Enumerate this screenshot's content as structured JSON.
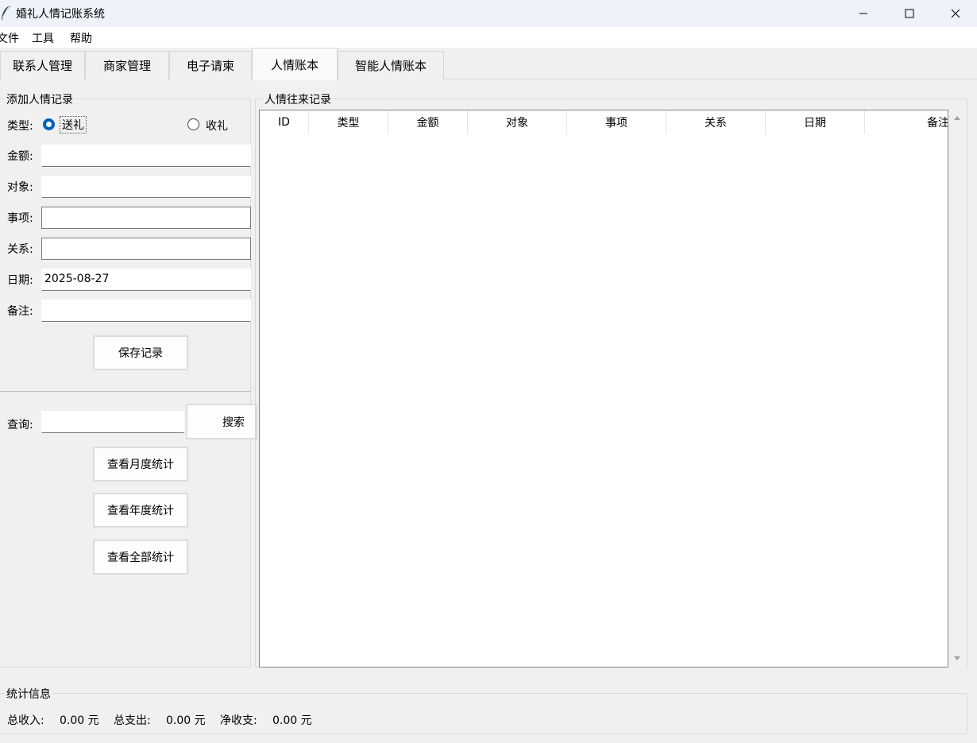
{
  "window": {
    "title": "婚礼人情记账系统"
  },
  "menu": [
    "文件",
    "工具",
    "帮助"
  ],
  "tabs": [
    "联系人管理",
    "商家管理",
    "电子请柬",
    "人情账本",
    "智能人情账本"
  ],
  "form": {
    "group_title": "添加人情记录",
    "type_label": "类型:",
    "type_options": [
      "送礼",
      "收礼"
    ],
    "selected_type": "送礼",
    "fields": [
      {
        "label": "金额:",
        "value": ""
      },
      {
        "label": "对象:",
        "value": ""
      },
      {
        "label": "事项:",
        "value": ""
      },
      {
        "label": "关系:",
        "value": ""
      },
      {
        "label": "日期:",
        "value": "2025-08-27"
      },
      {
        "label": "备注:",
        "value": ""
      }
    ],
    "save_button": "保存记录"
  },
  "query": {
    "label": "查询:",
    "value": "",
    "search_button": "搜索",
    "monthly_button": "查看月度统计",
    "yearly_button": "查看年度统计",
    "all_button": "查看全部统计"
  },
  "records": {
    "group_title": "人情往来记录",
    "columns": [
      "ID",
      "类型",
      "金额",
      "对象",
      "事项",
      "关系",
      "日期",
      "备注"
    ],
    "rows": []
  },
  "stats": {
    "group_title": "统计信息",
    "income_label": "总收入:",
    "income_value": "0.00 元",
    "expense_label": "总支出:",
    "expense_value": "0.00 元",
    "net_label": "净收支:",
    "net_value": "0.00 元"
  },
  "colors": {
    "accent": "#005fb8",
    "titlebar": "#eef2f9",
    "window_bg": "#f0f0f0"
  }
}
